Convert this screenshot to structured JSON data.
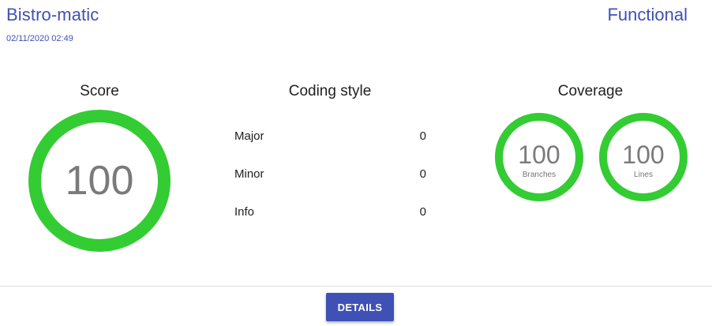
{
  "header": {
    "project": "Bistro-matic",
    "timestamp": "02/11/2020 02:49",
    "category": "Functional"
  },
  "score": {
    "title": "Score",
    "value": "100"
  },
  "coding_style": {
    "title": "Coding style",
    "rows": [
      {
        "label": "Major",
        "value": "0"
      },
      {
        "label": "Minor",
        "value": "0"
      },
      {
        "label": "Info",
        "value": "0"
      }
    ]
  },
  "coverage": {
    "title": "Coverage",
    "branches": {
      "value": "100",
      "label": "Branches"
    },
    "lines": {
      "value": "100",
      "label": "Lines"
    }
  },
  "actions": {
    "details_label": "DETAILS"
  },
  "colors": {
    "accent": "#3f51b5",
    "success_ring": "#33cc33",
    "ring_value_text": "#7a7a7a"
  }
}
